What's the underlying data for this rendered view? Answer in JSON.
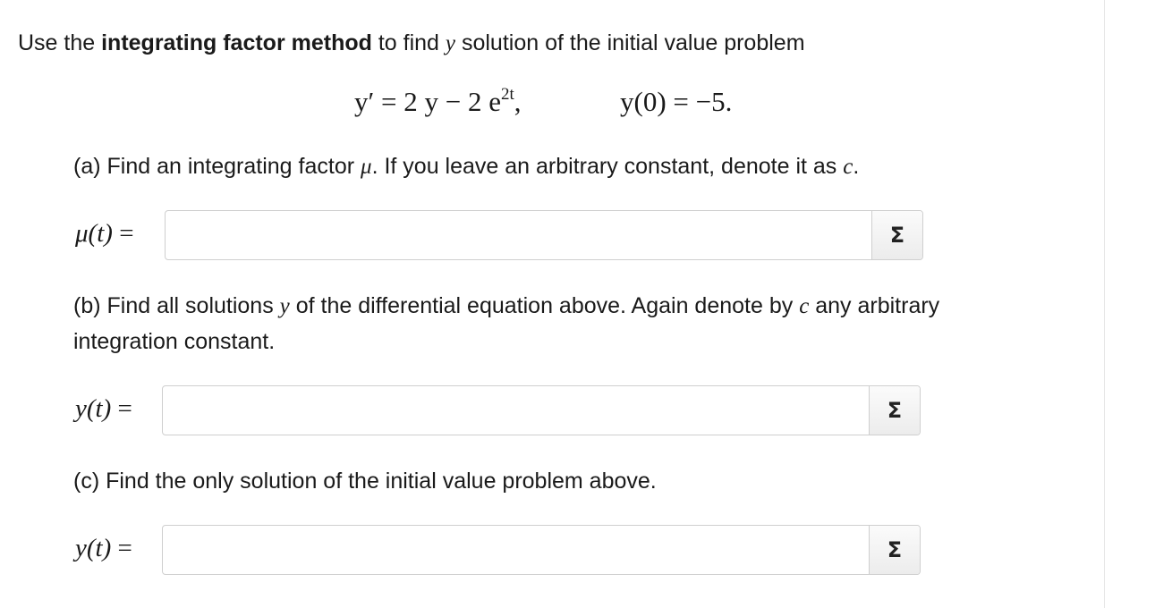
{
  "intro": {
    "lead": "Use the ",
    "method": "integrating factor method",
    "mid": " to find ",
    "var": "y",
    "tail": " solution of the initial value problem"
  },
  "equation": {
    "lhs": "y′ = 2 y − 2 e",
    "exp": "2t",
    "comma": ",",
    "initial": "y(0) = −5."
  },
  "part_a": {
    "prompt_lead": "(a) Find an integrating factor ",
    "mu": "μ",
    "prompt_tail": ". If you leave an arbitrary constant, denote it as ",
    "c": "c",
    "end": ".",
    "label": "μ(t) =",
    "value": ""
  },
  "part_b": {
    "line1_lead": "(b) Find all solutions ",
    "y": "y",
    "line1_mid": " of the differential equation above. Again denote by ",
    "c": "c",
    "line1_tail": " any arbitrary",
    "line2": "integration constant.",
    "label": "y(t) =",
    "value": ""
  },
  "part_c": {
    "prompt": "(c) Find the only solution of the initial value problem above.",
    "label": "y(t) =",
    "value": ""
  },
  "equation_button_icon": "sigma-icon",
  "equation_button_glyph": "Σ"
}
